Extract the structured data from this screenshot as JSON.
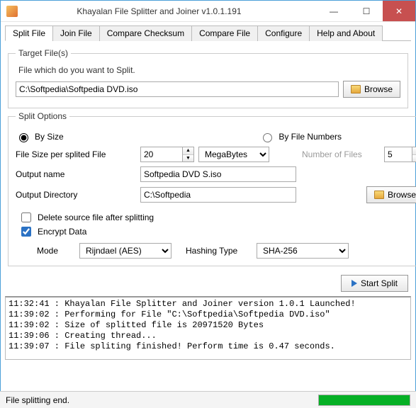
{
  "window": {
    "title": "Khayalan File Splitter and Joiner v1.0.1.191"
  },
  "tabs": [
    "Split File",
    "Join File",
    "Compare Checksum",
    "Compare File",
    "Configure",
    "Help and About"
  ],
  "target": {
    "legend": "Target File(s)",
    "hint": "File which do you want to Split.",
    "path": "C:\\Softpedia\\Softpedia DVD.iso",
    "browse": "Browse"
  },
  "options": {
    "legend": "Split Options",
    "by_size": "By Size",
    "by_num": "By File Numbers",
    "size_label": "File Size per splited File",
    "size_value": "20",
    "unit": "MegaBytes",
    "nof_label": "Number of Files",
    "nof_value": "5",
    "outname_label": "Output name",
    "outname": "Softpedia DVD S.iso",
    "outdir_label": "Output Directory",
    "outdir": "C:\\Softpedia",
    "browse": "Browse",
    "delete_src": "Delete source file after splitting",
    "encrypt": "Encrypt Data",
    "mode_label": "Mode",
    "mode": "Rijndael (AES)",
    "hash_label": "Hashing Type",
    "hash": "SHA-256"
  },
  "start": "Start Split",
  "log_lines": [
    "11:32:41 : Khayalan File Splitter and Joiner version 1.0.1 Launched!",
    "11:39:02 : Performing for File \"C:\\Softpedia\\Softpedia DVD.iso\"",
    "11:39:02 : Size of splitted file is 20971520 Bytes",
    "11:39:06 : Creating thread...",
    "11:39:07 : File spliting finished! Perform time is 0.47 seconds."
  ],
  "status": {
    "text": "File splitting end.",
    "progress_pct": 100
  }
}
